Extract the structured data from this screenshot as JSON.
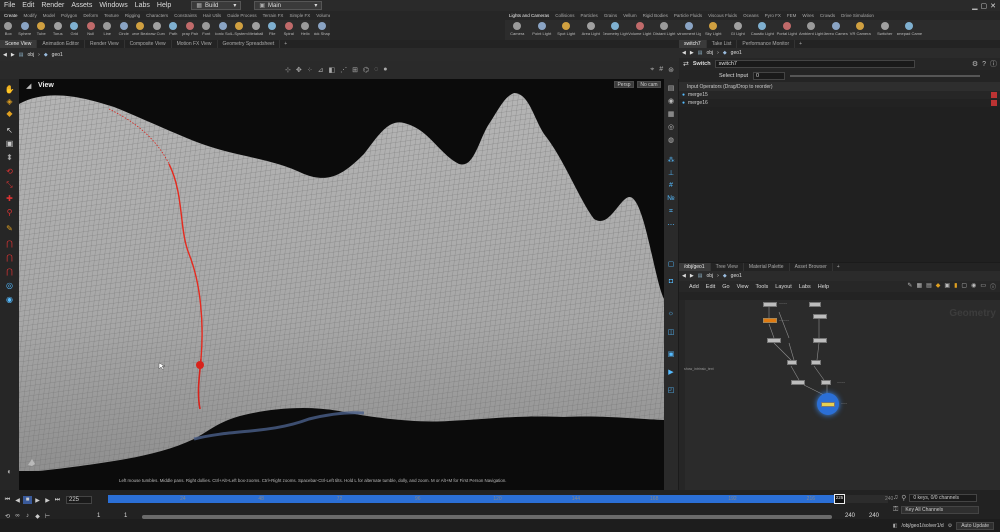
{
  "menubar": {
    "items": [
      "File",
      "Edit",
      "Render",
      "Assets",
      "Windows",
      "Labs",
      "Help"
    ],
    "desktop_1": "Build",
    "desktop_2": "Main"
  },
  "shelf": {
    "left_tabs": [
      "Create",
      "Modify",
      "Model",
      "Polygon",
      "Deform",
      "Texture",
      "Rigging",
      "Characters",
      "Constraints",
      "Hair Utils",
      "Guide Process",
      "Terrain FX",
      "Simple FX",
      "Volume"
    ],
    "right_tabs": [
      "Lights and Cameras",
      "Collisions",
      "Particles",
      "Grains",
      "Vellum",
      "Rigid Bodies",
      "Particle Fluids",
      "Viscous Fluids",
      "Oceans",
      "Pyro FX",
      "FEM",
      "Wires",
      "Crowds",
      "Drive Simulation"
    ],
    "left_tools": [
      "Box",
      "Sphere",
      "Tube",
      "Torus",
      "Grid",
      "Null",
      "Line",
      "Circle",
      "Curve Bezier",
      "Draw Curve",
      "Path",
      "Spray Paint",
      "Font",
      "Platonic Solids",
      "L-System",
      "Metaball",
      "File",
      "Spiral",
      "Helix",
      "Quick Shapes"
    ],
    "right_tools": [
      "Camera",
      "Point Light",
      "Spot Light",
      "Area Light",
      "Geometry Light",
      "Volume Light",
      "Distant Light",
      "Environment Light",
      "Sky Light",
      "GI Light",
      "Caustic Light",
      "Portal Light",
      "Ambient Light",
      "Stereo Camera",
      "VR Camera",
      "Switcher",
      "Gamepad Camera"
    ]
  },
  "viewer": {
    "tabs": [
      "Scene View",
      "Animation Editor",
      "Render View",
      "Composite View",
      "Motion FX View",
      "Geometry Spreadsheet"
    ],
    "path": "obj",
    "node": "geo1",
    "title": "View",
    "persp": "Persp",
    "cam": "No cam",
    "status": "Left mouse tumbles. Middle pans. Right dollies. Ctrl+Alt+Left box-zooms. Ctrl+Right zooms. Spacebar-Ctrl-Left tilts. Hold L for alternate tumble, dolly, and zoom. M or Alt+M for First Person Navigation."
  },
  "params": {
    "tabs": [
      "switch7",
      "Take List",
      "Performance Monitor"
    ],
    "path": "obj",
    "node": "geo1",
    "type": "Switch",
    "name": "switch7",
    "select_label": "Select Input",
    "select_value": "0",
    "ops_header": "Input Operators (Drag/Drop to reorder)",
    "inputs": [
      "merge15",
      "merge16"
    ]
  },
  "network": {
    "tabs": [
      "/obj/geo1",
      "Tree View",
      "Material Palette",
      "Asset Browser"
    ],
    "path": "obj",
    "node": "geo1",
    "menu": [
      "Add",
      "Edit",
      "Go",
      "View",
      "Tools",
      "Layout",
      "Labs",
      "Help"
    ],
    "watermark": "Geometry",
    "side_label": "show_intrinsic_text"
  },
  "timeline": {
    "frame": "225",
    "ticks": [
      "24",
      "48",
      "72",
      "96",
      "120",
      "144",
      "168",
      "192",
      "216",
      "240"
    ],
    "range_start": "1",
    "range_start2": "1",
    "range_end": "240",
    "range_end2": "240",
    "current_marker": "225",
    "keys_info": "0 keys, 0/0 channels",
    "key_all": "Key All Channels",
    "path_status": "/obj/geo1/solver1/d",
    "auto_update": "Auto Update"
  },
  "colors": {
    "accent": "#e06a00",
    "curve": "#d8231c",
    "selection": "#2b6fd6"
  }
}
